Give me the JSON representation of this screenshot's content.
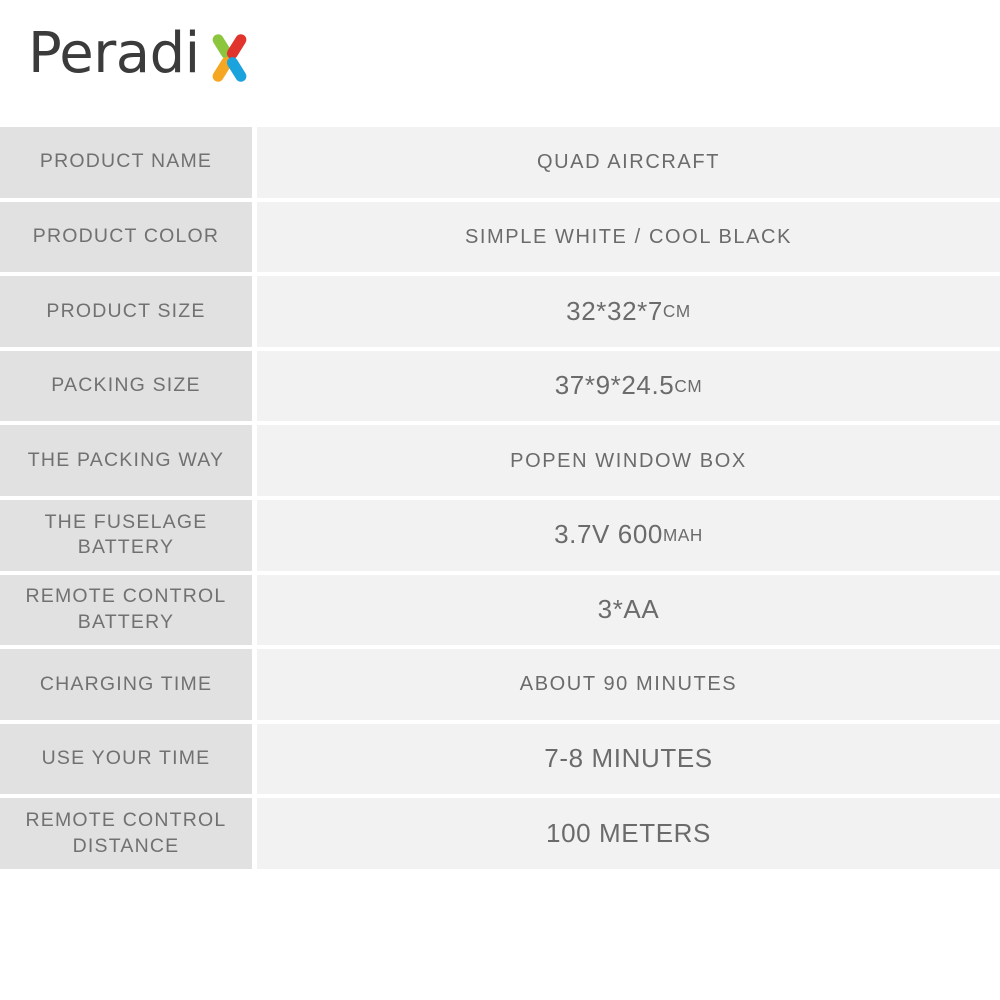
{
  "brand": {
    "name_text": "Peradi",
    "full_name": "Peradix",
    "mark_colors": {
      "green": "#8cc63f",
      "red": "#e0342c",
      "orange": "#f5a623",
      "blue": "#1ba3dd",
      "wordmark": "#3b3b3b"
    }
  },
  "theme": {
    "label_bg": "#e1e1e1",
    "value_bg": "#f2f2f2",
    "page_bg": "#ffffff",
    "text": "#6e6e6e"
  },
  "spec_table": {
    "rows": [
      {
        "label": "PRODUCT NAME",
        "value": "QUAD AIRCRAFT",
        "unit": "",
        "style": "small-text"
      },
      {
        "label": "PRODUCT COLOR",
        "value": "SIMPLE WHITE / COOL BLACK",
        "unit": "",
        "style": "small-text"
      },
      {
        "label": "PRODUCT SIZE",
        "value": "32*32*7",
        "unit": "CM",
        "style": "big-text"
      },
      {
        "label": "PACKING SIZE",
        "value": "37*9*24.5",
        "unit": "CM",
        "style": "big-text"
      },
      {
        "label": "THE PACKING WAY",
        "value": "POPEN WINDOW BOX",
        "unit": "",
        "style": "small-text"
      },
      {
        "label": "THE FUSELAGE BATTERY",
        "value": "3.7V 600",
        "unit": "MAH",
        "style": "big-text"
      },
      {
        "label": "REMOTE CONTROL BATTERY",
        "value": "3*AA",
        "unit": "",
        "style": "big-text"
      },
      {
        "label": "CHARGING TIME",
        "value": "ABOUT 90 MINUTES",
        "unit": "",
        "style": "small-text"
      },
      {
        "label": "USE YOUR TIME",
        "value": "7-8 MINUTES",
        "unit": "",
        "style": "big-text"
      },
      {
        "label": "REMOTE CONTROL DISTANCE",
        "value": "100 METERS",
        "unit": "",
        "style": "big-text"
      }
    ]
  }
}
